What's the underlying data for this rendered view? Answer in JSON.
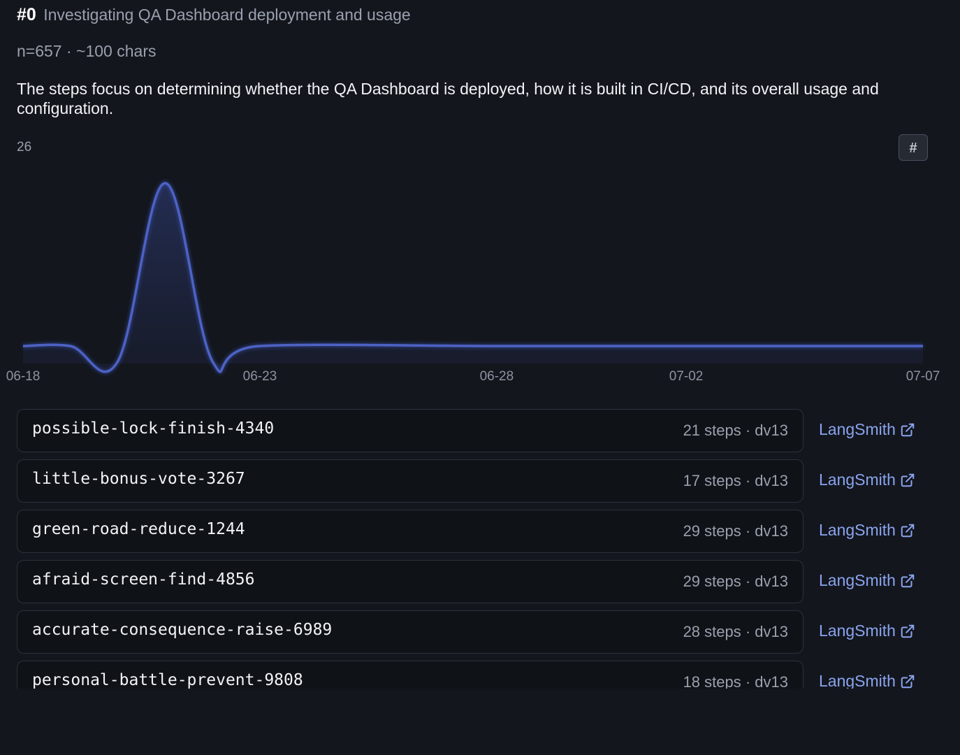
{
  "header": {
    "number": "#0",
    "title": "Investigating QA Dashboard deployment and usage"
  },
  "meta": "n=657 · ~100 chars",
  "summary": "The steps focus on determining whether the QA Dashboard is deployed, how it is built in CI/CD, and its overall usage and configuration.",
  "chart_toggle_label": "#",
  "chart_data": {
    "type": "area",
    "y_max_label": "26",
    "x_tick_labels": [
      "06-18",
      "06-23",
      "06-28",
      "07-02",
      "07-07"
    ],
    "x_range": [
      "2024-06-18",
      "2024-07-07"
    ],
    "ylim": [
      0,
      26
    ],
    "line_color": "#4a5fc0",
    "fill_color": "#1f2742",
    "points": [
      {
        "x": "06-18",
        "y": 1
      },
      {
        "x": "06-19",
        "y": 1
      },
      {
        "x": "06-20",
        "y": 0
      },
      {
        "x": "06-21",
        "y": 26
      },
      {
        "x": "06-22",
        "y": 0
      },
      {
        "x": "06-23",
        "y": 1
      },
      {
        "x": "06-28",
        "y": 1
      },
      {
        "x": "07-02",
        "y": 1
      },
      {
        "x": "07-07",
        "y": 1
      }
    ]
  },
  "runs": [
    {
      "name": "possible-lock-finish-4340",
      "meta": "21 steps · dv13",
      "link": "LangSmith"
    },
    {
      "name": "little-bonus-vote-3267",
      "meta": "17 steps · dv13",
      "link": "LangSmith"
    },
    {
      "name": "green-road-reduce-1244",
      "meta": "29 steps · dv13",
      "link": "LangSmith"
    },
    {
      "name": "afraid-screen-find-4856",
      "meta": "29 steps · dv13",
      "link": "LangSmith"
    },
    {
      "name": "accurate-consequence-raise-6989",
      "meta": "28 steps · dv13",
      "link": "LangSmith"
    },
    {
      "name": "personal-battle-prevent-9808",
      "meta": "18 steps · dv13",
      "link": "LangSmith"
    }
  ],
  "icons": {
    "external_link": "external-link-icon"
  }
}
